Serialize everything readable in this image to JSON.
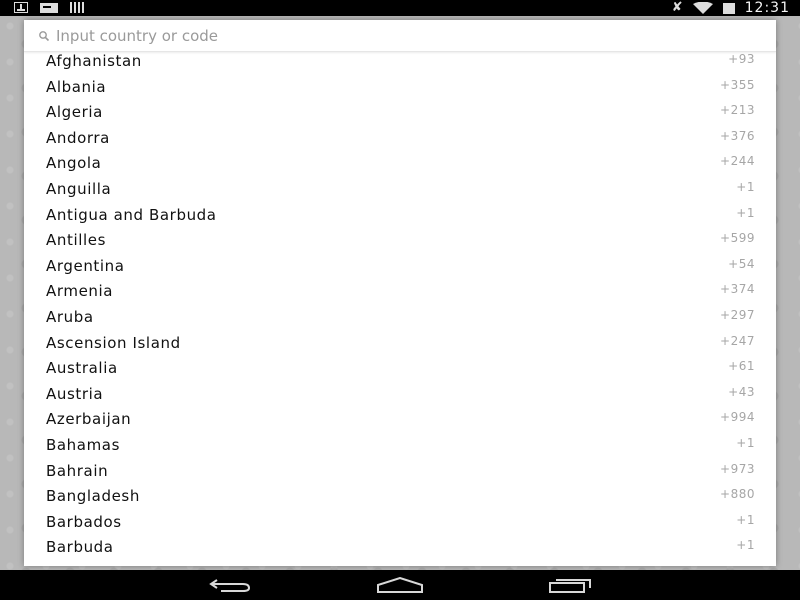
{
  "status_bar": {
    "time": "12:31",
    "icons": [
      "download-icon",
      "keyboard-card-icon",
      "signal-bars-icon",
      "mute-icon",
      "wifi-icon",
      "battery-icon"
    ]
  },
  "search": {
    "placeholder": "Input country or code",
    "value": ""
  },
  "countries": [
    {
      "name": "Afghanistan",
      "code": "+93"
    },
    {
      "name": "Albania",
      "code": "+355"
    },
    {
      "name": "Algeria",
      "code": "+213"
    },
    {
      "name": "Andorra",
      "code": "+376"
    },
    {
      "name": "Angola",
      "code": "+244"
    },
    {
      "name": "Anguilla",
      "code": "+1"
    },
    {
      "name": "Antigua and Barbuda",
      "code": "+1"
    },
    {
      "name": "Antilles",
      "code": "+599"
    },
    {
      "name": "Argentina",
      "code": "+54"
    },
    {
      "name": "Armenia",
      "code": "+374"
    },
    {
      "name": "Aruba",
      "code": "+297"
    },
    {
      "name": "Ascension Island",
      "code": "+247"
    },
    {
      "name": "Australia",
      "code": "+61"
    },
    {
      "name": "Austria",
      "code": "+43"
    },
    {
      "name": "Azerbaijan",
      "code": "+994"
    },
    {
      "name": "Bahamas",
      "code": "+1"
    },
    {
      "name": "Bahrain",
      "code": "+973"
    },
    {
      "name": "Bangladesh",
      "code": "+880"
    },
    {
      "name": "Barbados",
      "code": "+1"
    },
    {
      "name": "Barbuda",
      "code": "+1"
    }
  ],
  "nav_bar": {
    "buttons": [
      "back-icon",
      "home-icon",
      "recents-icon"
    ]
  },
  "colors": {
    "status_bar_bg": "#000000",
    "dialog_bg": "#ffffff",
    "country_text": "#111111",
    "code_text": "#a6a6a6",
    "placeholder_text": "#9a9a9a"
  }
}
